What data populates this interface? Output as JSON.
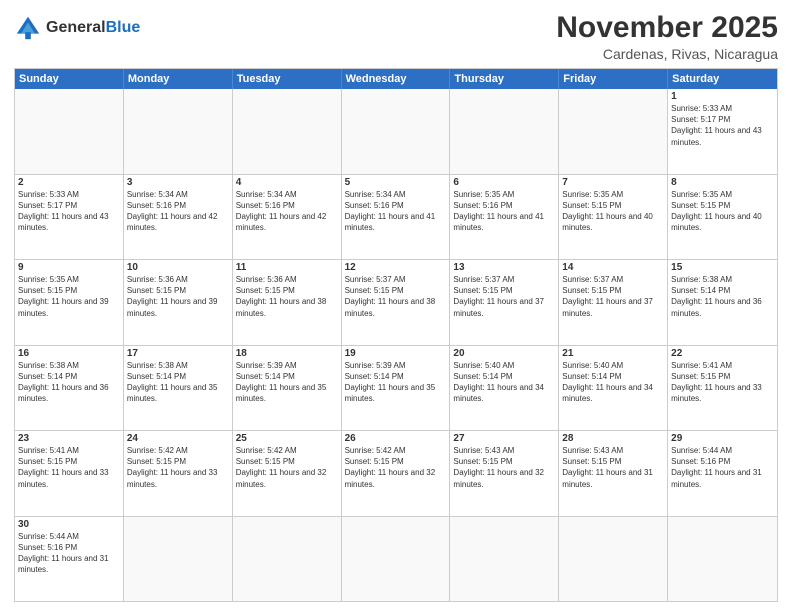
{
  "header": {
    "logo_general": "General",
    "logo_blue": "Blue",
    "main_title": "November 2025",
    "sub_title": "Cardenas, Rivas, Nicaragua"
  },
  "calendar": {
    "days_of_week": [
      "Sunday",
      "Monday",
      "Tuesday",
      "Wednesday",
      "Thursday",
      "Friday",
      "Saturday"
    ],
    "weeks": [
      [
        {
          "day": "",
          "empty": true
        },
        {
          "day": "",
          "empty": true
        },
        {
          "day": "",
          "empty": true
        },
        {
          "day": "",
          "empty": true
        },
        {
          "day": "",
          "empty": true
        },
        {
          "day": "",
          "empty": true
        },
        {
          "day": "1",
          "sunrise": "Sunrise: 5:33 AM",
          "sunset": "Sunset: 5:17 PM",
          "daylight": "Daylight: 11 hours and 43 minutes."
        }
      ],
      [
        {
          "day": "2",
          "sunrise": "Sunrise: 5:33 AM",
          "sunset": "Sunset: 5:17 PM",
          "daylight": "Daylight: 11 hours and 43 minutes."
        },
        {
          "day": "3",
          "sunrise": "Sunrise: 5:34 AM",
          "sunset": "Sunset: 5:16 PM",
          "daylight": "Daylight: 11 hours and 42 minutes."
        },
        {
          "day": "4",
          "sunrise": "Sunrise: 5:34 AM",
          "sunset": "Sunset: 5:16 PM",
          "daylight": "Daylight: 11 hours and 42 minutes."
        },
        {
          "day": "5",
          "sunrise": "Sunrise: 5:34 AM",
          "sunset": "Sunset: 5:16 PM",
          "daylight": "Daylight: 11 hours and 41 minutes."
        },
        {
          "day": "6",
          "sunrise": "Sunrise: 5:35 AM",
          "sunset": "Sunset: 5:16 PM",
          "daylight": "Daylight: 11 hours and 41 minutes."
        },
        {
          "day": "7",
          "sunrise": "Sunrise: 5:35 AM",
          "sunset": "Sunset: 5:15 PM",
          "daylight": "Daylight: 11 hours and 40 minutes."
        },
        {
          "day": "8",
          "sunrise": "Sunrise: 5:35 AM",
          "sunset": "Sunset: 5:15 PM",
          "daylight": "Daylight: 11 hours and 40 minutes."
        }
      ],
      [
        {
          "day": "9",
          "sunrise": "Sunrise: 5:35 AM",
          "sunset": "Sunset: 5:15 PM",
          "daylight": "Daylight: 11 hours and 39 minutes."
        },
        {
          "day": "10",
          "sunrise": "Sunrise: 5:36 AM",
          "sunset": "Sunset: 5:15 PM",
          "daylight": "Daylight: 11 hours and 39 minutes."
        },
        {
          "day": "11",
          "sunrise": "Sunrise: 5:36 AM",
          "sunset": "Sunset: 5:15 PM",
          "daylight": "Daylight: 11 hours and 38 minutes."
        },
        {
          "day": "12",
          "sunrise": "Sunrise: 5:37 AM",
          "sunset": "Sunset: 5:15 PM",
          "daylight": "Daylight: 11 hours and 38 minutes."
        },
        {
          "day": "13",
          "sunrise": "Sunrise: 5:37 AM",
          "sunset": "Sunset: 5:15 PM",
          "daylight": "Daylight: 11 hours and 37 minutes."
        },
        {
          "day": "14",
          "sunrise": "Sunrise: 5:37 AM",
          "sunset": "Sunset: 5:15 PM",
          "daylight": "Daylight: 11 hours and 37 minutes."
        },
        {
          "day": "15",
          "sunrise": "Sunrise: 5:38 AM",
          "sunset": "Sunset: 5:14 PM",
          "daylight": "Daylight: 11 hours and 36 minutes."
        }
      ],
      [
        {
          "day": "16",
          "sunrise": "Sunrise: 5:38 AM",
          "sunset": "Sunset: 5:14 PM",
          "daylight": "Daylight: 11 hours and 36 minutes."
        },
        {
          "day": "17",
          "sunrise": "Sunrise: 5:38 AM",
          "sunset": "Sunset: 5:14 PM",
          "daylight": "Daylight: 11 hours and 35 minutes."
        },
        {
          "day": "18",
          "sunrise": "Sunrise: 5:39 AM",
          "sunset": "Sunset: 5:14 PM",
          "daylight": "Daylight: 11 hours and 35 minutes."
        },
        {
          "day": "19",
          "sunrise": "Sunrise: 5:39 AM",
          "sunset": "Sunset: 5:14 PM",
          "daylight": "Daylight: 11 hours and 35 minutes."
        },
        {
          "day": "20",
          "sunrise": "Sunrise: 5:40 AM",
          "sunset": "Sunset: 5:14 PM",
          "daylight": "Daylight: 11 hours and 34 minutes."
        },
        {
          "day": "21",
          "sunrise": "Sunrise: 5:40 AM",
          "sunset": "Sunset: 5:14 PM",
          "daylight": "Daylight: 11 hours and 34 minutes."
        },
        {
          "day": "22",
          "sunrise": "Sunrise: 5:41 AM",
          "sunset": "Sunset: 5:15 PM",
          "daylight": "Daylight: 11 hours and 33 minutes."
        }
      ],
      [
        {
          "day": "23",
          "sunrise": "Sunrise: 5:41 AM",
          "sunset": "Sunset: 5:15 PM",
          "daylight": "Daylight: 11 hours and 33 minutes."
        },
        {
          "day": "24",
          "sunrise": "Sunrise: 5:42 AM",
          "sunset": "Sunset: 5:15 PM",
          "daylight": "Daylight: 11 hours and 33 minutes."
        },
        {
          "day": "25",
          "sunrise": "Sunrise: 5:42 AM",
          "sunset": "Sunset: 5:15 PM",
          "daylight": "Daylight: 11 hours and 32 minutes."
        },
        {
          "day": "26",
          "sunrise": "Sunrise: 5:42 AM",
          "sunset": "Sunset: 5:15 PM",
          "daylight": "Daylight: 11 hours and 32 minutes."
        },
        {
          "day": "27",
          "sunrise": "Sunrise: 5:43 AM",
          "sunset": "Sunset: 5:15 PM",
          "daylight": "Daylight: 11 hours and 32 minutes."
        },
        {
          "day": "28",
          "sunrise": "Sunrise: 5:43 AM",
          "sunset": "Sunset: 5:15 PM",
          "daylight": "Daylight: 11 hours and 31 minutes."
        },
        {
          "day": "29",
          "sunrise": "Sunrise: 5:44 AM",
          "sunset": "Sunset: 5:16 PM",
          "daylight": "Daylight: 11 hours and 31 minutes."
        }
      ],
      [
        {
          "day": "30",
          "sunrise": "Sunrise: 5:44 AM",
          "sunset": "Sunset: 5:16 PM",
          "daylight": "Daylight: 11 hours and 31 minutes."
        },
        {
          "day": "",
          "empty": true
        },
        {
          "day": "",
          "empty": true
        },
        {
          "day": "",
          "empty": true
        },
        {
          "day": "",
          "empty": true
        },
        {
          "day": "",
          "empty": true
        },
        {
          "day": "",
          "empty": true
        }
      ]
    ]
  }
}
